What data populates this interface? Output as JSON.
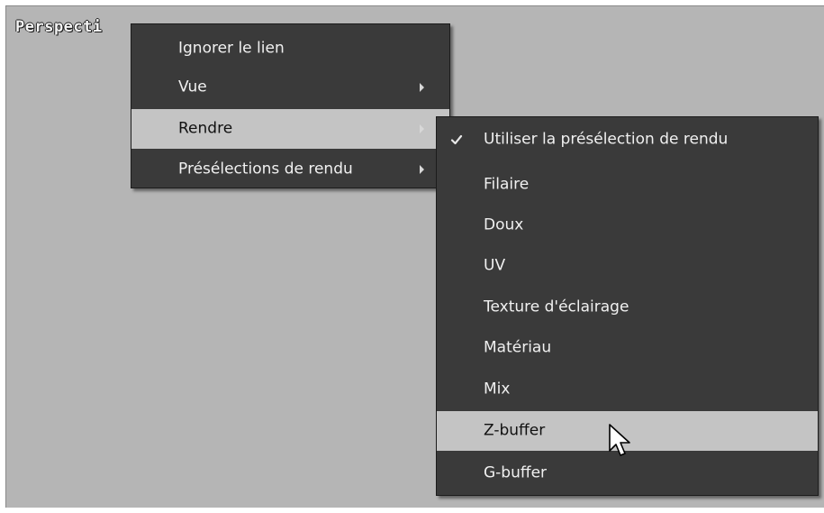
{
  "viewport": {
    "label": "Perspecti"
  },
  "context_menu": {
    "items": [
      {
        "label": "Ignorer le lien",
        "has_submenu": false
      },
      {
        "label": "Vue",
        "has_submenu": true
      },
      {
        "label": "Rendre",
        "has_submenu": true,
        "active": true
      },
      {
        "label": "Présélections de rendu",
        "has_submenu": true
      }
    ]
  },
  "render_submenu": {
    "items": [
      {
        "label": "Utiliser la présélection de rendu",
        "checked": true
      },
      {
        "label": "Filaire"
      },
      {
        "label": "Doux"
      },
      {
        "label": "UV"
      },
      {
        "label": "Texture d'éclairage"
      },
      {
        "label": "Matériau"
      },
      {
        "label": "Mix"
      },
      {
        "label": "Z-buffer",
        "hovered": true
      },
      {
        "label": "G-buffer"
      }
    ]
  },
  "icons": {
    "submenu_arrow": "chevron-right-icon",
    "checkmark": "check-icon",
    "cursor": "mouse-pointer-icon"
  },
  "colors": {
    "viewport_bg": "#b5b5b5",
    "menu_bg": "#3a3a3a",
    "menu_text": "#f0f0f0",
    "highlight_bg": "#c4c4c4"
  }
}
